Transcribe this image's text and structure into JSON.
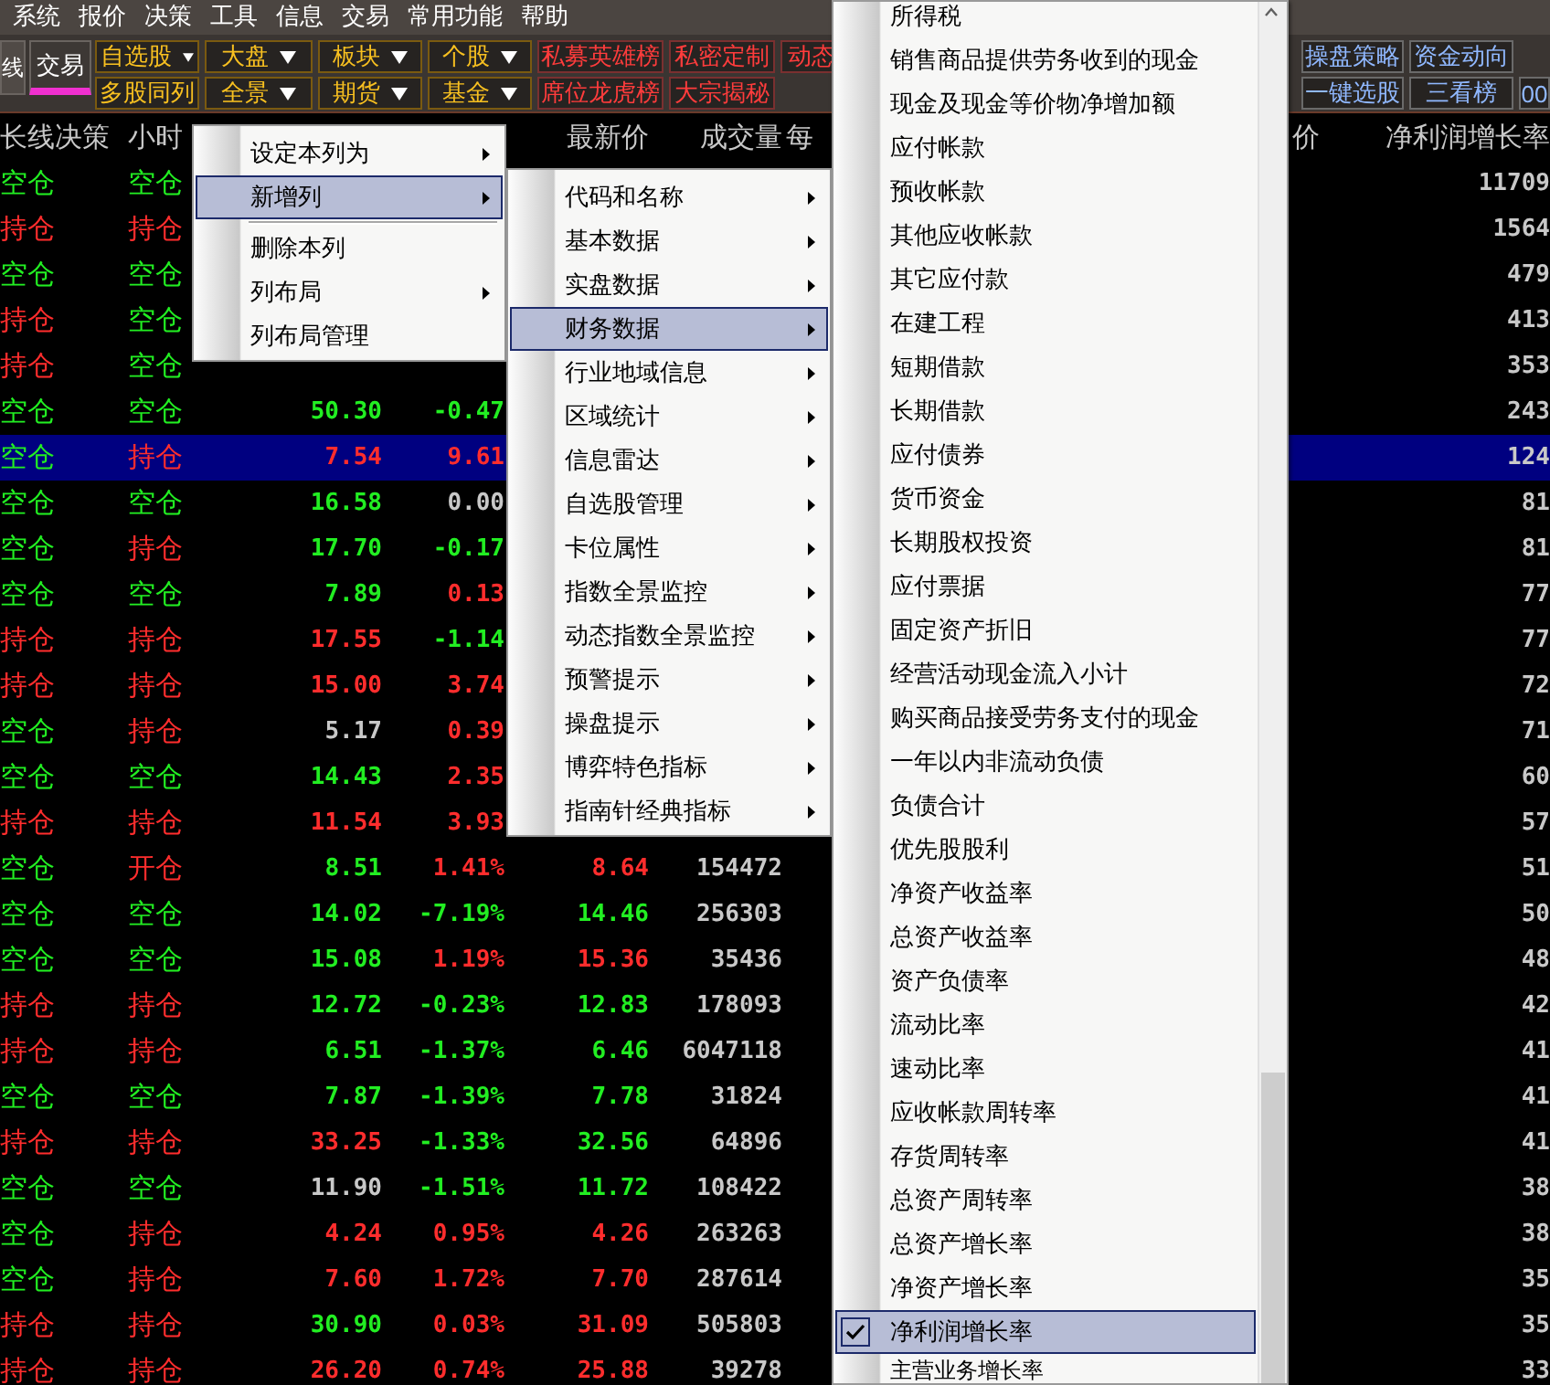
{
  "menu_bar": [
    "系统",
    "报价",
    "决策",
    "工具",
    "信息",
    "交易",
    "常用功能",
    "帮助"
  ],
  "toolbar": {
    "tabs": [
      {
        "label": "线",
        "selected": false
      },
      {
        "label": "交易",
        "selected": true
      }
    ],
    "rows": [
      [
        {
          "label": "自选股",
          "kind": "quote",
          "dropdown": true
        },
        {
          "label": "大盘",
          "kind": "quote",
          "dropdown": true
        },
        {
          "label": "板块",
          "kind": "quote",
          "dropdown": true
        },
        {
          "label": "个股",
          "kind": "quote",
          "dropdown": true
        },
        {
          "label": "私募英雄榜",
          "kind": "feature",
          "dropdown": false
        },
        {
          "label": "私密定制",
          "kind": "feature",
          "dropdown": false
        },
        {
          "label": "动态",
          "kind": "feature",
          "dropdown": false
        }
      ],
      [
        {
          "label": "多股同列",
          "kind": "quote",
          "dropdown": false
        },
        {
          "label": "全景",
          "kind": "quote",
          "dropdown": true
        },
        {
          "label": "期货",
          "kind": "quote",
          "dropdown": true
        },
        {
          "label": "基金",
          "kind": "quote",
          "dropdown": true
        },
        {
          "label": "席位龙虎榜",
          "kind": "feature",
          "dropdown": false
        },
        {
          "label": "大宗揭秘",
          "kind": "feature",
          "dropdown": false
        }
      ]
    ],
    "right_rows": [
      [
        {
          "label": "操盘策略",
          "kind": "tool",
          "dropdown": false
        },
        {
          "label": "资金动向",
          "kind": "tool",
          "dropdown": false
        }
      ],
      [
        {
          "label": "一键选股",
          "kind": "tool",
          "dropdown": false
        },
        {
          "label": "三看榜",
          "kind": "tool",
          "dropdown": false
        },
        {
          "label": "00",
          "kind": "tool",
          "dropdown": false
        }
      ]
    ]
  },
  "table": {
    "columns": {
      "long_term": "长线决策",
      "hourly": "小时",
      "latest": "最新价",
      "volume": "成交量",
      "column_7": "每",
      "column_8": "价",
      "net_profit_growth": "净利润增长率"
    },
    "rows": [
      {
        "selected": false,
        "long_term": {
          "text": "空仓",
          "color": "#22ee22"
        },
        "hourly": {
          "text": "空仓",
          "color": "#22ee22"
        },
        "net_profit_growth": {
          "text": "11709",
          "color": "#c8c8c8"
        }
      },
      {
        "selected": false,
        "long_term": {
          "text": "持仓",
          "color": "#ff2d2d"
        },
        "hourly": {
          "text": "持仓",
          "color": "#ff2d2d"
        },
        "net_profit_growth": {
          "text": "1564",
          "color": "#c8c8c8"
        }
      },
      {
        "selected": false,
        "long_term": {
          "text": "空仓",
          "color": "#22ee22"
        },
        "hourly": {
          "text": "空仓",
          "color": "#22ee22"
        },
        "net_profit_growth": {
          "text": "479",
          "color": "#c8c8c8"
        }
      },
      {
        "selected": false,
        "long_term": {
          "text": "持仓",
          "color": "#ff2d2d"
        },
        "hourly": {
          "text": "空仓",
          "color": "#22ee22"
        },
        "net_profit_growth": {
          "text": "413",
          "color": "#c8c8c8"
        }
      },
      {
        "selected": false,
        "long_term": {
          "text": "持仓",
          "color": "#ff2d2d"
        },
        "hourly": {
          "text": "空仓",
          "color": "#22ee22"
        },
        "net_profit_growth": {
          "text": "353",
          "color": "#c8c8c8"
        }
      },
      {
        "selected": false,
        "long_term": {
          "text": "空仓",
          "color": "#22ee22"
        },
        "hourly": {
          "text": "空仓",
          "color": "#22ee22"
        },
        "column_3": {
          "text": "50.30",
          "color": "#22ee22"
        },
        "column_4": {
          "text": "-0.47",
          "color": "#22ee22"
        },
        "net_profit_growth": {
          "text": "243",
          "color": "#c8c8c8"
        }
      },
      {
        "selected": true,
        "long_term": {
          "text": "空仓",
          "color": "#22ee22"
        },
        "hourly": {
          "text": "持仓",
          "color": "#ff2d2d"
        },
        "column_3": {
          "text": "7.54",
          "color": "#ff2d2d"
        },
        "column_4": {
          "text": "9.61",
          "color": "#ff2d2d"
        },
        "net_profit_growth": {
          "text": "124",
          "color": "#c8c8c8"
        }
      },
      {
        "selected": false,
        "long_term": {
          "text": "空仓",
          "color": "#22ee22"
        },
        "hourly": {
          "text": "空仓",
          "color": "#22ee22"
        },
        "column_3": {
          "text": "16.58",
          "color": "#22ee22"
        },
        "column_4": {
          "text": "0.00",
          "color": "#c8c8c8"
        },
        "net_profit_growth": {
          "text": "81",
          "color": "#c8c8c8"
        }
      },
      {
        "selected": false,
        "long_term": {
          "text": "空仓",
          "color": "#22ee22"
        },
        "hourly": {
          "text": "持仓",
          "color": "#ff2d2d"
        },
        "column_3": {
          "text": "17.70",
          "color": "#22ee22"
        },
        "column_4": {
          "text": "-0.17",
          "color": "#22ee22"
        },
        "net_profit_growth": {
          "text": "81",
          "color": "#c8c8c8"
        }
      },
      {
        "selected": false,
        "long_term": {
          "text": "空仓",
          "color": "#22ee22"
        },
        "hourly": {
          "text": "空仓",
          "color": "#22ee22"
        },
        "column_3": {
          "text": "7.89",
          "color": "#22ee22"
        },
        "column_4": {
          "text": "0.13",
          "color": "#ff2d2d"
        },
        "net_profit_growth": {
          "text": "77",
          "color": "#c8c8c8"
        }
      },
      {
        "selected": false,
        "long_term": {
          "text": "持仓",
          "color": "#ff2d2d"
        },
        "hourly": {
          "text": "持仓",
          "color": "#ff2d2d"
        },
        "column_3": {
          "text": "17.55",
          "color": "#ff2d2d"
        },
        "column_4": {
          "text": "-1.14",
          "color": "#22ee22"
        },
        "net_profit_growth": {
          "text": "77",
          "color": "#c8c8c8"
        }
      },
      {
        "selected": false,
        "long_term": {
          "text": "持仓",
          "color": "#ff2d2d"
        },
        "hourly": {
          "text": "持仓",
          "color": "#ff2d2d"
        },
        "column_3": {
          "text": "15.00",
          "color": "#ff2d2d"
        },
        "column_4": {
          "text": "3.74",
          "color": "#ff2d2d"
        },
        "net_profit_growth": {
          "text": "72",
          "color": "#c8c8c8"
        }
      },
      {
        "selected": false,
        "long_term": {
          "text": "空仓",
          "color": "#22ee22"
        },
        "hourly": {
          "text": "持仓",
          "color": "#ff2d2d"
        },
        "column_3": {
          "text": "5.17",
          "color": "#c8c8c8"
        },
        "column_4": {
          "text": "0.39",
          "color": "#ff2d2d"
        },
        "net_profit_growth": {
          "text": "71",
          "color": "#c8c8c8"
        }
      },
      {
        "selected": false,
        "long_term": {
          "text": "空仓",
          "color": "#22ee22"
        },
        "hourly": {
          "text": "空仓",
          "color": "#22ee22"
        },
        "column_3": {
          "text": "14.43",
          "color": "#22ee22"
        },
        "column_4": {
          "text": "2.35",
          "color": "#ff2d2d"
        },
        "net_profit_growth": {
          "text": "60",
          "color": "#c8c8c8"
        }
      },
      {
        "selected": false,
        "long_term": {
          "text": "持仓",
          "color": "#ff2d2d"
        },
        "hourly": {
          "text": "持仓",
          "color": "#ff2d2d"
        },
        "column_3": {
          "text": "11.54",
          "color": "#ff2d2d"
        },
        "column_4": {
          "text": "3.93",
          "color": "#ff2d2d"
        },
        "net_profit_growth": {
          "text": "57",
          "color": "#c8c8c8"
        }
      },
      {
        "selected": false,
        "long_term": {
          "text": "空仓",
          "color": "#22ee22"
        },
        "hourly": {
          "text": "开仓",
          "color": "#ff2d2d"
        },
        "column_3": {
          "text": "8.51",
          "color": "#22ee22"
        },
        "column_4": {
          "text": "1.41%",
          "color": "#ff2d2d"
        },
        "latest": {
          "text": "8.64",
          "color": "#ff2d2d"
        },
        "volume": {
          "text": "154472",
          "color": "#c8c8c8"
        },
        "net_profit_growth": {
          "text": "51",
          "color": "#c8c8c8"
        }
      },
      {
        "selected": false,
        "long_term": {
          "text": "空仓",
          "color": "#22ee22"
        },
        "hourly": {
          "text": "空仓",
          "color": "#22ee22"
        },
        "column_3": {
          "text": "14.02",
          "color": "#22ee22"
        },
        "column_4": {
          "text": "-7.19%",
          "color": "#22ee22"
        },
        "latest": {
          "text": "14.46",
          "color": "#22ee22"
        },
        "volume": {
          "text": "256303",
          "color": "#c8c8c8"
        },
        "net_profit_growth": {
          "text": "50",
          "color": "#c8c8c8"
        }
      },
      {
        "selected": false,
        "long_term": {
          "text": "空仓",
          "color": "#22ee22"
        },
        "hourly": {
          "text": "空仓",
          "color": "#22ee22"
        },
        "column_3": {
          "text": "15.08",
          "color": "#22ee22"
        },
        "column_4": {
          "text": "1.19%",
          "color": "#ff2d2d"
        },
        "latest": {
          "text": "15.36",
          "color": "#ff2d2d"
        },
        "volume": {
          "text": "35436",
          "color": "#c8c8c8"
        },
        "net_profit_growth": {
          "text": "48",
          "color": "#c8c8c8"
        }
      },
      {
        "selected": false,
        "long_term": {
          "text": "持仓",
          "color": "#ff2d2d"
        },
        "hourly": {
          "text": "持仓",
          "color": "#ff2d2d"
        },
        "column_3": {
          "text": "12.72",
          "color": "#22ee22"
        },
        "column_4": {
          "text": "-0.23%",
          "color": "#22ee22"
        },
        "latest": {
          "text": "12.83",
          "color": "#22ee22"
        },
        "volume": {
          "text": "178093",
          "color": "#c8c8c8"
        },
        "net_profit_growth": {
          "text": "42",
          "color": "#c8c8c8"
        }
      },
      {
        "selected": false,
        "long_term": {
          "text": "持仓",
          "color": "#ff2d2d"
        },
        "hourly": {
          "text": "持仓",
          "color": "#ff2d2d"
        },
        "column_3": {
          "text": "6.51",
          "color": "#22ee22"
        },
        "column_4": {
          "text": "-1.37%",
          "color": "#22ee22"
        },
        "latest": {
          "text": "6.46",
          "color": "#22ee22"
        },
        "volume": {
          "text": "6047118",
          "color": "#c8c8c8"
        },
        "net_profit_growth": {
          "text": "41",
          "color": "#c8c8c8"
        }
      },
      {
        "selected": false,
        "long_term": {
          "text": "空仓",
          "color": "#22ee22"
        },
        "hourly": {
          "text": "空仓",
          "color": "#22ee22"
        },
        "column_3": {
          "text": "7.87",
          "color": "#22ee22"
        },
        "column_4": {
          "text": "-1.39%",
          "color": "#22ee22"
        },
        "latest": {
          "text": "7.78",
          "color": "#22ee22"
        },
        "volume": {
          "text": "31824",
          "color": "#c8c8c8"
        },
        "net_profit_growth": {
          "text": "41",
          "color": "#c8c8c8"
        }
      },
      {
        "selected": false,
        "long_term": {
          "text": "持仓",
          "color": "#ff2d2d"
        },
        "hourly": {
          "text": "持仓",
          "color": "#ff2d2d"
        },
        "column_3": {
          "text": "33.25",
          "color": "#ff2d2d"
        },
        "column_4": {
          "text": "-1.33%",
          "color": "#22ee22"
        },
        "latest": {
          "text": "32.56",
          "color": "#22ee22"
        },
        "volume": {
          "text": "64896",
          "color": "#c8c8c8"
        },
        "net_profit_growth": {
          "text": "41",
          "color": "#c8c8c8"
        }
      },
      {
        "selected": false,
        "long_term": {
          "text": "空仓",
          "color": "#22ee22"
        },
        "hourly": {
          "text": "空仓",
          "color": "#22ee22"
        },
        "column_3": {
          "text": "11.90",
          "color": "#c8c8c8"
        },
        "column_4": {
          "text": "-1.51%",
          "color": "#22ee22"
        },
        "latest": {
          "text": "11.72",
          "color": "#22ee22"
        },
        "volume": {
          "text": "108422",
          "color": "#c8c8c8"
        },
        "net_profit_growth": {
          "text": "38",
          "color": "#c8c8c8"
        }
      },
      {
        "selected": false,
        "long_term": {
          "text": "空仓",
          "color": "#22ee22"
        },
        "hourly": {
          "text": "持仓",
          "color": "#ff2d2d"
        },
        "column_3": {
          "text": "4.24",
          "color": "#ff2d2d"
        },
        "column_4": {
          "text": "0.95%",
          "color": "#ff2d2d"
        },
        "latest": {
          "text": "4.26",
          "color": "#ff2d2d"
        },
        "volume": {
          "text": "263263",
          "color": "#c8c8c8"
        },
        "net_profit_growth": {
          "text": "38",
          "color": "#c8c8c8"
        }
      },
      {
        "selected": false,
        "long_term": {
          "text": "空仓",
          "color": "#22ee22"
        },
        "hourly": {
          "text": "持仓",
          "color": "#ff2d2d"
        },
        "column_3": {
          "text": "7.60",
          "color": "#ff2d2d"
        },
        "column_4": {
          "text": "1.72%",
          "color": "#ff2d2d"
        },
        "latest": {
          "text": "7.70",
          "color": "#ff2d2d"
        },
        "volume": {
          "text": "287614",
          "color": "#c8c8c8"
        },
        "net_profit_growth": {
          "text": "35",
          "color": "#c8c8c8"
        }
      },
      {
        "selected": false,
        "long_term": {
          "text": "持仓",
          "color": "#ff2d2d"
        },
        "hourly": {
          "text": "持仓",
          "color": "#ff2d2d"
        },
        "column_3": {
          "text": "30.90",
          "color": "#22ee22"
        },
        "column_4": {
          "text": "0.03%",
          "color": "#ff2d2d"
        },
        "latest": {
          "text": "31.09",
          "color": "#ff2d2d"
        },
        "volume": {
          "text": "505803",
          "color": "#c8c8c8"
        },
        "net_profit_growth": {
          "text": "35",
          "color": "#c8c8c8"
        }
      },
      {
        "selected": false,
        "long_term": {
          "text": "持仓",
          "color": "#ff2d2d"
        },
        "hourly": {
          "text": "持仓",
          "color": "#ff2d2d"
        },
        "column_3": {
          "text": "26.20",
          "color": "#ff2d2d"
        },
        "column_4": {
          "text": "0.74%",
          "color": "#ff2d2d"
        },
        "latest": {
          "text": "25.88",
          "color": "#ff2d2d"
        },
        "volume": {
          "text": "39278",
          "color": "#c8c8c8"
        },
        "net_profit_growth": {
          "text": "33",
          "color": "#c8c8c8"
        }
      }
    ]
  },
  "menus": [
    {
      "items": [
        {
          "kind": "item",
          "label": "设定本列为",
          "submenu": true,
          "selected": false
        },
        {
          "kind": "item",
          "label": "新增列",
          "submenu": true,
          "selected": true
        },
        {
          "kind": "separator"
        },
        {
          "kind": "item",
          "label": "删除本列",
          "submenu": false,
          "selected": false
        },
        {
          "kind": "item",
          "label": "列布局",
          "submenu": true,
          "selected": false
        },
        {
          "kind": "item",
          "label": "列布局管理",
          "submenu": false,
          "selected": false
        }
      ]
    },
    {
      "items": [
        {
          "kind": "item",
          "label": "代码和名称",
          "submenu": true,
          "selected": false
        },
        {
          "kind": "item",
          "label": "基本数据",
          "submenu": true,
          "selected": false
        },
        {
          "kind": "item",
          "label": "实盘数据",
          "submenu": true,
          "selected": false
        },
        {
          "kind": "item",
          "label": "财务数据",
          "submenu": true,
          "selected": true
        },
        {
          "kind": "item",
          "label": "行业地域信息",
          "submenu": true,
          "selected": false
        },
        {
          "kind": "item",
          "label": "区域统计",
          "submenu": true,
          "selected": false
        },
        {
          "kind": "item",
          "label": "信息雷达",
          "submenu": true,
          "selected": false
        },
        {
          "kind": "item",
          "label": "自选股管理",
          "submenu": true,
          "selected": false
        },
        {
          "kind": "item",
          "label": "卡位属性",
          "submenu": true,
          "selected": false
        },
        {
          "kind": "item",
          "label": "指数全景监控",
          "submenu": true,
          "selected": false
        },
        {
          "kind": "item",
          "label": "动态指数全景监控",
          "submenu": true,
          "selected": false
        },
        {
          "kind": "item",
          "label": "预警提示",
          "submenu": true,
          "selected": false
        },
        {
          "kind": "item",
          "label": "操盘提示",
          "submenu": true,
          "selected": false
        },
        {
          "kind": "item",
          "label": "博弈特色指标",
          "submenu": true,
          "selected": false
        },
        {
          "kind": "item",
          "label": "指南针经典指标",
          "submenu": true,
          "selected": false
        }
      ]
    },
    {
      "items": [
        {
          "kind": "item",
          "label": "所得税",
          "checked": false,
          "selected": false
        },
        {
          "kind": "item",
          "label": "销售商品提供劳务收到的现金",
          "checked": false,
          "selected": false
        },
        {
          "kind": "item",
          "label": "现金及现金等价物净增加额",
          "checked": false,
          "selected": false
        },
        {
          "kind": "item",
          "label": "应付帐款",
          "checked": false,
          "selected": false
        },
        {
          "kind": "item",
          "label": "预收帐款",
          "checked": false,
          "selected": false
        },
        {
          "kind": "item",
          "label": "其他应收帐款",
          "checked": false,
          "selected": false
        },
        {
          "kind": "item",
          "label": "其它应付款",
          "checked": false,
          "selected": false
        },
        {
          "kind": "item",
          "label": "在建工程",
          "checked": false,
          "selected": false
        },
        {
          "kind": "item",
          "label": "短期借款",
          "checked": false,
          "selected": false
        },
        {
          "kind": "item",
          "label": "长期借款",
          "checked": false,
          "selected": false
        },
        {
          "kind": "item",
          "label": "应付债券",
          "checked": false,
          "selected": false
        },
        {
          "kind": "item",
          "label": "货币资金",
          "checked": false,
          "selected": false
        },
        {
          "kind": "item",
          "label": "长期股权投资",
          "checked": false,
          "selected": false
        },
        {
          "kind": "item",
          "label": "应付票据",
          "checked": false,
          "selected": false
        },
        {
          "kind": "item",
          "label": "固定资产折旧",
          "checked": false,
          "selected": false
        },
        {
          "kind": "item",
          "label": "经营活动现金流入小计",
          "checked": false,
          "selected": false
        },
        {
          "kind": "item",
          "label": "购买商品接受劳务支付的现金",
          "checked": false,
          "selected": false
        },
        {
          "kind": "item",
          "label": "一年以内非流动负债",
          "checked": false,
          "selected": false
        },
        {
          "kind": "item",
          "label": "负债合计",
          "checked": false,
          "selected": false
        },
        {
          "kind": "item",
          "label": "优先股股利",
          "checked": false,
          "selected": false
        },
        {
          "kind": "item",
          "label": "净资产收益率",
          "checked": false,
          "selected": false
        },
        {
          "kind": "item",
          "label": "总资产收益率",
          "checked": false,
          "selected": false
        },
        {
          "kind": "item",
          "label": "资产负债率",
          "checked": false,
          "selected": false
        },
        {
          "kind": "item",
          "label": "流动比率",
          "checked": false,
          "selected": false
        },
        {
          "kind": "item",
          "label": "速动比率",
          "checked": false,
          "selected": false
        },
        {
          "kind": "item",
          "label": "应收帐款周转率",
          "checked": false,
          "selected": false
        },
        {
          "kind": "item",
          "label": "存货周转率",
          "checked": false,
          "selected": false
        },
        {
          "kind": "item",
          "label": "总资产周转率",
          "checked": false,
          "selected": false
        },
        {
          "kind": "item",
          "label": "总资产增长率",
          "checked": false,
          "selected": false
        },
        {
          "kind": "item",
          "label": "净资产增长率",
          "checked": false,
          "selected": false
        },
        {
          "kind": "item",
          "label": "净利润增长率",
          "checked": true,
          "selected": true
        },
        {
          "kind": "item",
          "label": "主营业务增长率",
          "checked": false,
          "selected": false
        }
      ]
    }
  ]
}
